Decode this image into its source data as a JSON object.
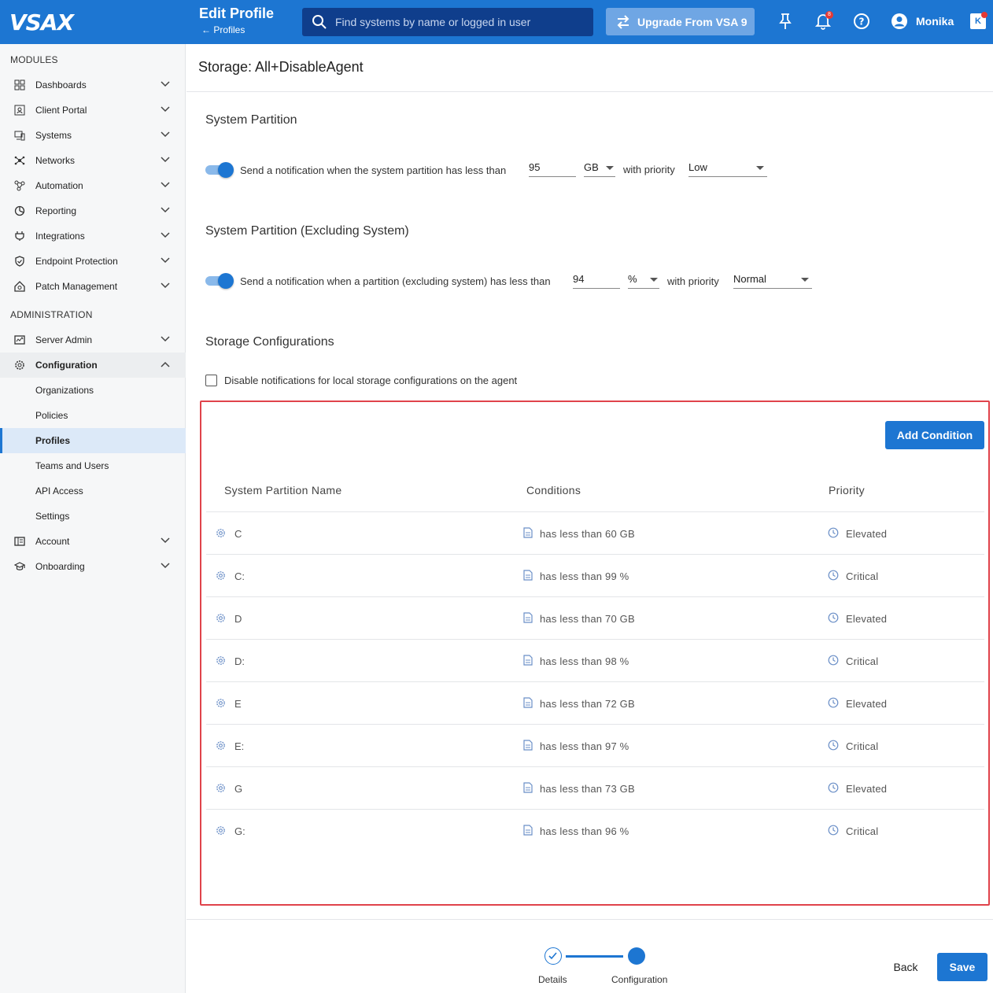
{
  "app": {
    "logo": "VSAX"
  },
  "header": {
    "title": "Edit Profile",
    "back_label": "Profiles",
    "search_placeholder": "Find systems by name or logged in user",
    "upgrade_label": "Upgrade From VSA 9",
    "notification_count": "8",
    "user_name": "Monika",
    "brand_badge": "K"
  },
  "sidebar": {
    "modules_heading": "MODULES",
    "modules": [
      {
        "label": "Dashboards"
      },
      {
        "label": "Client Portal"
      },
      {
        "label": "Systems"
      },
      {
        "label": "Networks"
      },
      {
        "label": "Automation"
      },
      {
        "label": "Reporting"
      },
      {
        "label": "Integrations"
      },
      {
        "label": "Endpoint Protection"
      },
      {
        "label": "Patch Management"
      }
    ],
    "admin_heading": "ADMINISTRATION",
    "admin": [
      {
        "label": "Server Admin"
      },
      {
        "label": "Configuration"
      },
      {
        "label": "Organizations"
      },
      {
        "label": "Policies"
      },
      {
        "label": "Profiles"
      },
      {
        "label": "Teams and Users"
      },
      {
        "label": "API Access"
      },
      {
        "label": "Settings"
      },
      {
        "label": "Account"
      },
      {
        "label": "Onboarding"
      }
    ]
  },
  "main": {
    "title": "Storage: All+DisableAgent",
    "system_partition": {
      "heading": "System Partition",
      "text": "Send a notification when the system partition has less than",
      "value": "95",
      "unit": "GB",
      "priority_label": "with priority",
      "priority": "Low"
    },
    "excluding_partition": {
      "heading": "System Partition (Excluding System)",
      "text": "Send a notification when a partition (excluding system) has less than",
      "value": "94",
      "unit": "%",
      "priority_label": "with priority",
      "priority": "Normal"
    },
    "storage_configs": {
      "heading": "Storage Configurations",
      "checkbox_label": "Disable notifications for local storage configurations on the agent",
      "checkbox_checked": false
    },
    "table": {
      "add_button": "Add Condition",
      "columns": [
        "System Partition Name",
        "Conditions",
        "Priority"
      ],
      "rows": [
        {
          "name": "C",
          "condition": "has less than 60 GB",
          "priority": "Elevated"
        },
        {
          "name": "C:",
          "condition": "has less than 99 %",
          "priority": "Critical"
        },
        {
          "name": "D",
          "condition": "has less than 70 GB",
          "priority": "Elevated"
        },
        {
          "name": "D:",
          "condition": "has less than 98 %",
          "priority": "Critical"
        },
        {
          "name": "E",
          "condition": "has less than 72 GB",
          "priority": "Elevated"
        },
        {
          "name": "E:",
          "condition": "has less than 97 %",
          "priority": "Critical"
        },
        {
          "name": "G",
          "condition": "has less than 73 GB",
          "priority": "Elevated"
        },
        {
          "name": "G:",
          "condition": "has less than 96 %",
          "priority": "Critical"
        }
      ]
    }
  },
  "footer": {
    "steps": [
      {
        "label": "Details",
        "state": "done"
      },
      {
        "label": "Configuration",
        "state": "current"
      }
    ],
    "back_label": "Back",
    "save_label": "Save"
  },
  "colors": {
    "accent": "#1d76d2",
    "highlight": "#e0434b"
  }
}
